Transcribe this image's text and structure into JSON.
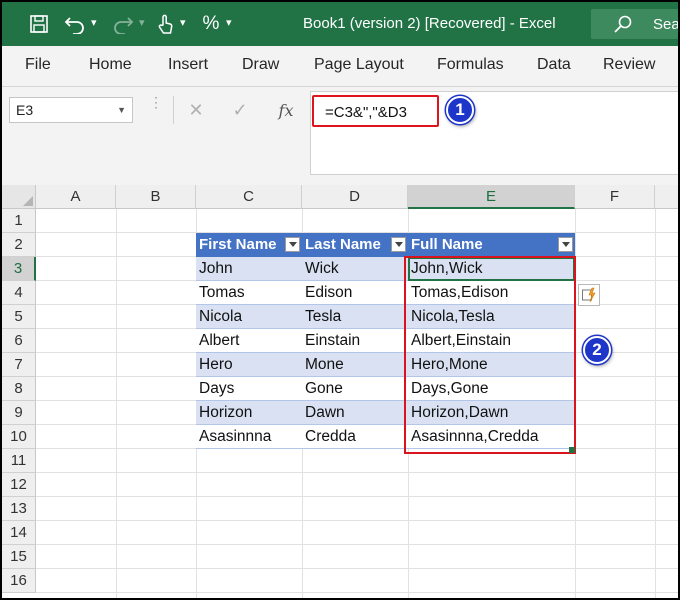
{
  "window": {
    "title": "Book1 (version 2) [Recovered]  -  Excel",
    "search_label": "Sear"
  },
  "ribbon": {
    "tabs": [
      "File",
      "Home",
      "Insert",
      "Draw",
      "Page Layout",
      "Formulas",
      "Data",
      "Review"
    ]
  },
  "formula_bar": {
    "name_box": "E3",
    "formula": "=C3&\",\"&D3",
    "fx_label": "fx"
  },
  "badges": {
    "one": "1",
    "two": "2"
  },
  "columns": [
    "A",
    "B",
    "C",
    "D",
    "E",
    "F"
  ],
  "rows": [
    "1",
    "2",
    "3",
    "4",
    "5",
    "6",
    "7",
    "8",
    "9",
    "10",
    "11",
    "12",
    "13",
    "14",
    "15",
    "16"
  ],
  "table": {
    "headers": [
      "First Name",
      "Last Name",
      "Full Name"
    ],
    "rows": [
      [
        "John",
        "Wick",
        "John,Wick"
      ],
      [
        "Tomas",
        "Edison",
        "Tomas,Edison"
      ],
      [
        "Nicola",
        "Tesla",
        "Nicola,Tesla"
      ],
      [
        "Albert",
        "Einstain",
        "Albert,Einstain"
      ],
      [
        "Hero",
        "Mone",
        "Hero,Mone"
      ],
      [
        "Days",
        "Gone",
        "Days,Gone"
      ],
      [
        "Horizon",
        "Dawn",
        "Horizon,Dawn"
      ],
      [
        "Asasinnna",
        "Credda",
        "Asasinnna,Credda"
      ]
    ]
  },
  "selection": {
    "active_cell": "E3"
  },
  "colors": {
    "excel_green": "#217346",
    "table_header": "#4472c4",
    "table_band": "#d9e1f2",
    "highlight_red": "#e0141e",
    "badge_blue": "#1d35c8"
  }
}
